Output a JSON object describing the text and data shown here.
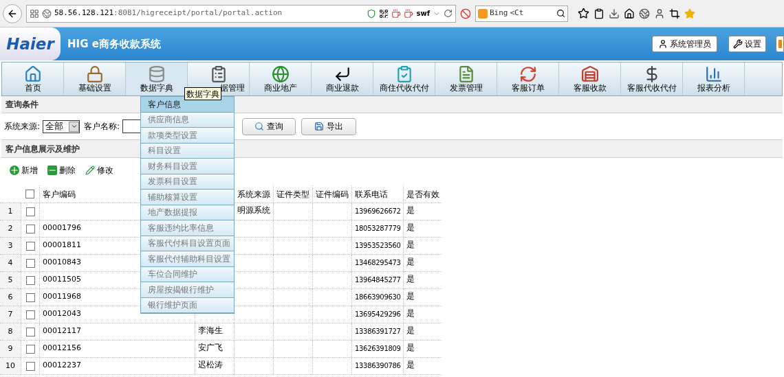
{
  "browser": {
    "url_host": "58.56.128.121",
    "url_rest": ":8081/higreceipt/portal/portal.action",
    "plugin_label": "swf",
    "search_engine": "Bing",
    "search_value": "<Ct"
  },
  "header": {
    "logo": "Haier",
    "title": "HIG e商务收款系统",
    "buttons": [
      "系统管理员",
      "设置"
    ]
  },
  "nav": [
    {
      "label": "首页",
      "selected": false
    },
    {
      "label": "基础设置",
      "selected": false
    },
    {
      "label": "数据字典",
      "selected": true
    },
    {
      "label": "据管理",
      "selected": false
    },
    {
      "label": "商业地产",
      "selected": false
    },
    {
      "label": "商业退款",
      "selected": false
    },
    {
      "label": "商住代收代付",
      "selected": false
    },
    {
      "label": "发票管理",
      "selected": false
    },
    {
      "label": "客服订单",
      "selected": false
    },
    {
      "label": "客服收款",
      "selected": false
    },
    {
      "label": "客服代收代付",
      "selected": false
    },
    {
      "label": "报表分析",
      "selected": false
    }
  ],
  "tooltip": "数据字典",
  "dropdown": [
    {
      "label": "客户信息",
      "selected": true
    },
    {
      "label": "供应商信息",
      "selected": false
    },
    {
      "label": "款项类型设置",
      "selected": false
    },
    {
      "label": "科目设置",
      "selected": false
    },
    {
      "label": "财务科目设置",
      "selected": false
    },
    {
      "label": "发票科目设置",
      "selected": false
    },
    {
      "label": "辅助核算设置",
      "selected": false
    },
    {
      "label": "地产数据提报",
      "selected": false
    },
    {
      "label": "客服违约比率信息",
      "selected": false
    },
    {
      "label": "客服代付科目设置页面",
      "selected": false
    },
    {
      "label": "客服代付辅助科目设置",
      "selected": false
    },
    {
      "label": "车位合同维护",
      "selected": false
    },
    {
      "label": "房屋按揭银行维护",
      "selected": false
    },
    {
      "label": "银行维护页面",
      "selected": false
    }
  ],
  "query": {
    "title": "查询条件",
    "source_label": "系统来源:",
    "source_value": "全部",
    "name_label": "客户名称:",
    "buttons": [
      "查询",
      "导出"
    ]
  },
  "section": {
    "title": "客户信息展示及维护",
    "actions": [
      "新增",
      "删除",
      "修改"
    ]
  },
  "table": {
    "header_checked": false,
    "columns": [
      "客户编码",
      "系统来源",
      "证件类型",
      "证件编码",
      "联系电话",
      "是否有效"
    ],
    "rows": [
      {
        "index": "1",
        "checked": false,
        "source": "明源系统",
        "phone": "13969626672",
        "valid": "是"
      },
      {
        "index": "2",
        "checked": false,
        "code": "00001796",
        "phone": "18053287779",
        "valid": "是"
      },
      {
        "index": "3",
        "checked": false,
        "code": "00001811",
        "phone": "13953523560",
        "valid": "是"
      },
      {
        "index": "4",
        "checked": false,
        "code": "00010843",
        "phone": "13468295473",
        "valid": "是"
      },
      {
        "index": "5",
        "checked": false,
        "code": "00011505",
        "phone": "13964845277",
        "valid": "是"
      },
      {
        "index": "6",
        "checked": false,
        "code": "00011968",
        "phone": "18663909630",
        "valid": "是"
      },
      {
        "index": "7",
        "checked": false,
        "code": "00012043",
        "phone": "13695429296",
        "valid": "是"
      },
      {
        "index": "8",
        "checked": false,
        "code": "00012117",
        "name": "李海生",
        "phone": "13386391727",
        "valid": "是"
      },
      {
        "index": "9",
        "checked": false,
        "code": "00012156",
        "name": "安广飞",
        "phone": "13626391809",
        "valid": "是"
      },
      {
        "index": "10",
        "checked": false,
        "code": "00012237",
        "name": "迟松涛",
        "phone": "13386390786",
        "valid": "是"
      }
    ]
  }
}
